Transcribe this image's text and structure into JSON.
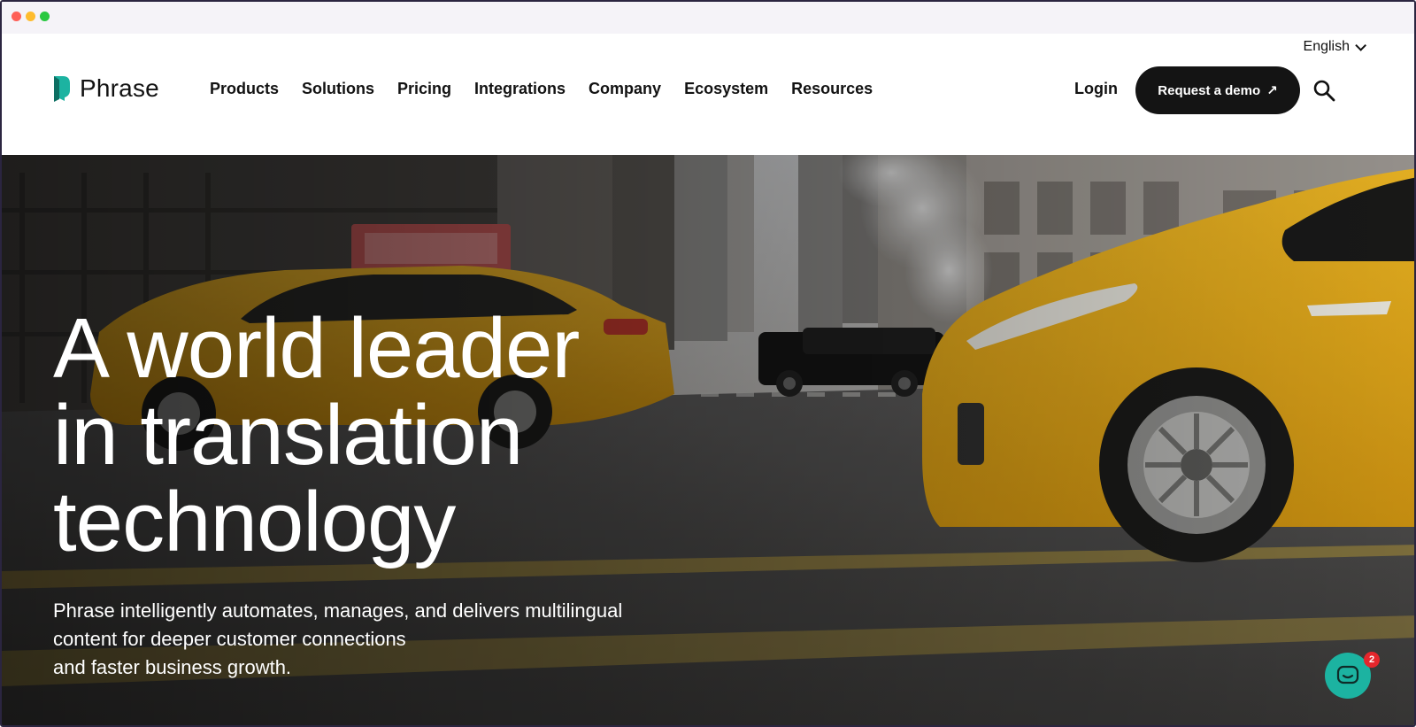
{
  "header": {
    "language": "English",
    "logo_text": "Phrase",
    "nav": [
      {
        "label": "Products"
      },
      {
        "label": "Solutions"
      },
      {
        "label": "Pricing"
      },
      {
        "label": "Integrations"
      },
      {
        "label": "Company"
      },
      {
        "label": "Ecosystem"
      },
      {
        "label": "Resources"
      }
    ],
    "login_label": "Login",
    "demo_label": "Request a demo",
    "demo_arrow": "↗"
  },
  "hero": {
    "headline_lines": [
      "A world leader",
      "in translation",
      "technology"
    ],
    "subtext_lines": [
      "Phrase intelligently automates, manages, and delivers multilingual",
      "content for deeper customer connections",
      "and faster business growth."
    ]
  },
  "chat": {
    "badge_count": "2"
  },
  "colors": {
    "brand_teal": "#1cb3a1",
    "taxi_yellow": "#e7a81c",
    "button_dark": "#141414",
    "badge_red": "#e5262c"
  },
  "icons": {
    "search": "search-icon",
    "chevron": "chevron-down-icon",
    "chat": "chat-icon",
    "logo": "phrase-logo-icon"
  }
}
